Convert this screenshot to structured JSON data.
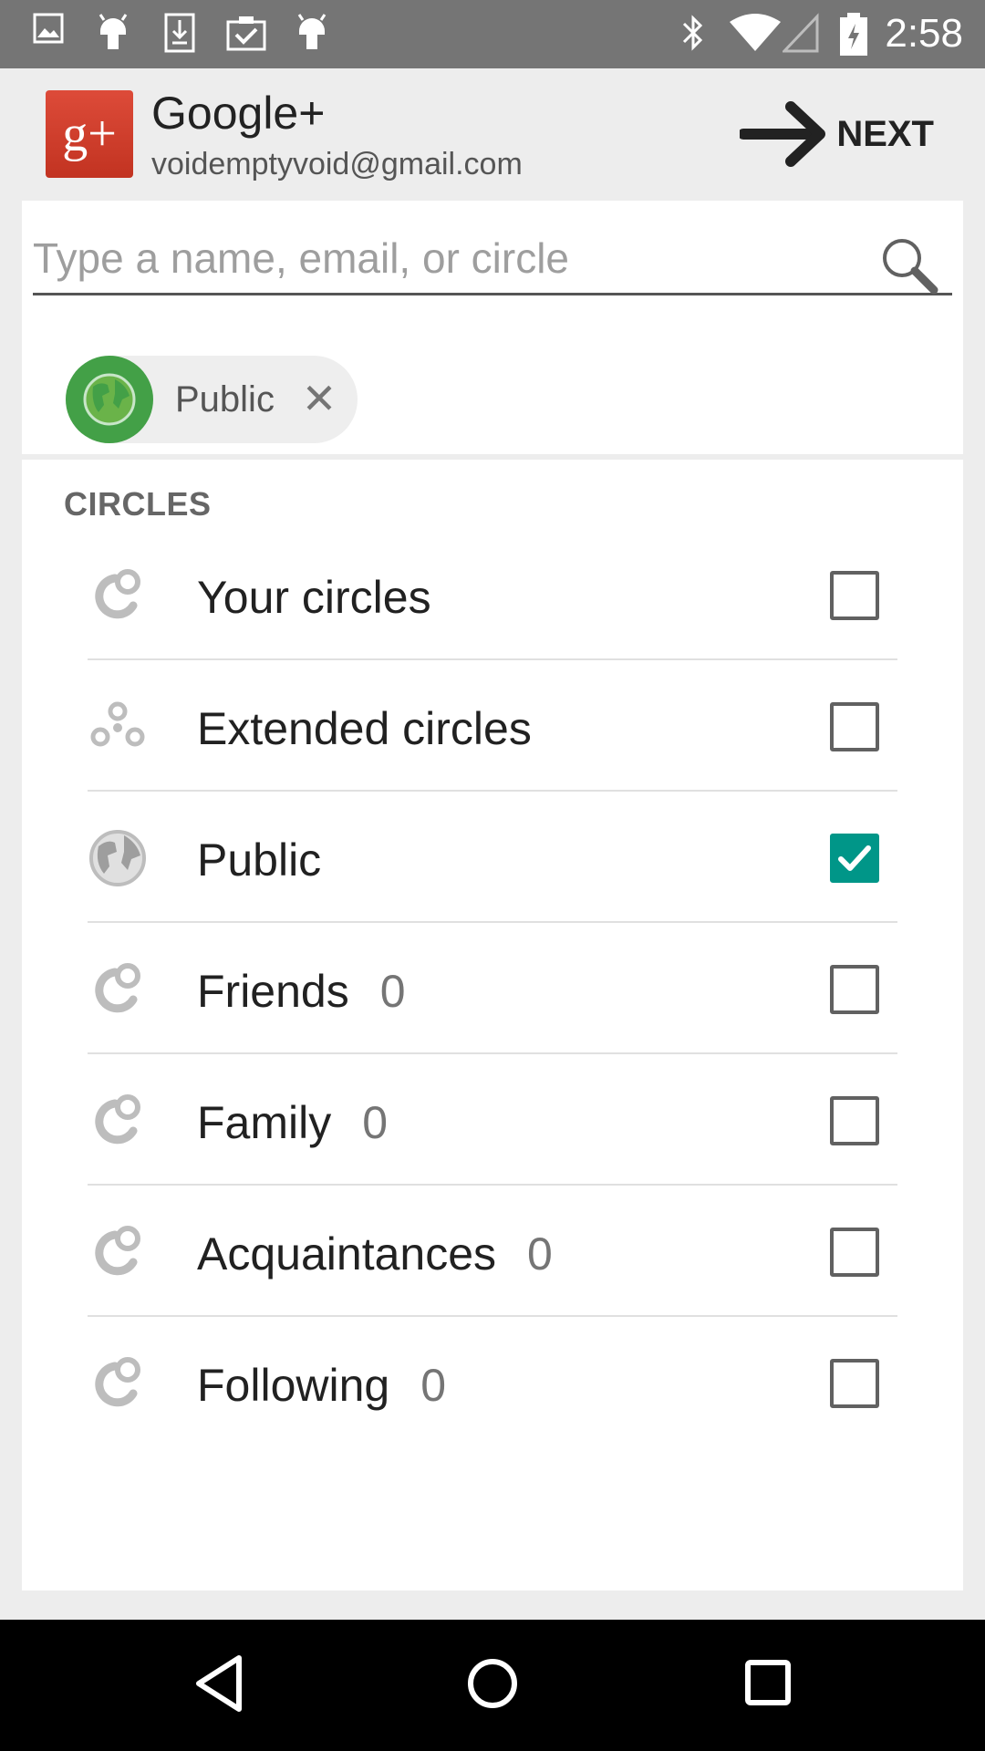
{
  "status_bar": {
    "time": "2:58",
    "left_icons": [
      "image-icon",
      "android-icon",
      "download-icon",
      "clipboard-check-icon",
      "android-icon"
    ],
    "right_icons": [
      "bluetooth-icon",
      "wifi-icon",
      "signal-icon",
      "battery-charging-icon"
    ]
  },
  "header": {
    "logo_text": "g+",
    "app_name": "Google+",
    "account": "voidemptyvoid@gmail.com",
    "next_label": "NEXT"
  },
  "search": {
    "placeholder": "Type a name, email, or circle",
    "value": ""
  },
  "chip": {
    "label": "Public",
    "close": "✕"
  },
  "section": {
    "title": "CIRCLES"
  },
  "circles": [
    {
      "label": "Your circles",
      "count": "",
      "icon": "circles-icon",
      "checked": false
    },
    {
      "label": "Extended circles",
      "count": "",
      "icon": "extended-circles-icon",
      "checked": false
    },
    {
      "label": "Public",
      "count": "",
      "icon": "globe-icon",
      "checked": true
    },
    {
      "label": "Friends",
      "count": "0",
      "icon": "circles-icon",
      "checked": false
    },
    {
      "label": "Family",
      "count": "0",
      "icon": "circles-icon",
      "checked": false
    },
    {
      "label": "Acquaintances",
      "count": "0",
      "icon": "circles-icon",
      "checked": false
    },
    {
      "label": "Following",
      "count": "0",
      "icon": "circles-icon",
      "checked": false
    }
  ],
  "colors": {
    "accent": "#009688",
    "brand": "#dd4b39",
    "chip_avatar": "#43a047"
  }
}
